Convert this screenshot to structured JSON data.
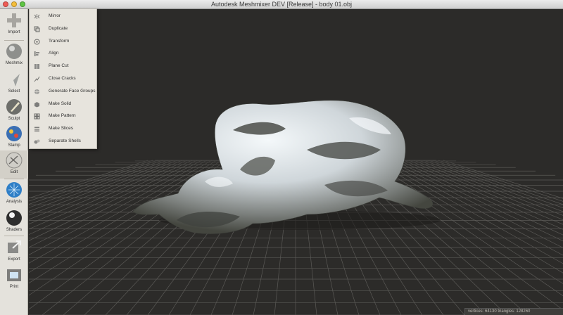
{
  "window": {
    "title": "Autodesk Meshmixer DEV [Release] - body 01.obj"
  },
  "toolbar": {
    "tools": [
      {
        "id": "import",
        "label": "Import",
        "icon": "plus-icon"
      },
      {
        "id": "meshmix",
        "label": "Meshmix",
        "icon": "meshmix-icon"
      },
      {
        "id": "select",
        "label": "Select",
        "icon": "select-arrow-icon"
      },
      {
        "id": "sculpt",
        "label": "Sculpt",
        "icon": "brush-icon"
      },
      {
        "id": "stamp",
        "label": "Stamp",
        "icon": "stamp-icon"
      },
      {
        "id": "edit",
        "label": "Edit",
        "icon": "edit-icon",
        "active": true
      },
      {
        "id": "analysis",
        "label": "Analysis",
        "icon": "analysis-icon"
      },
      {
        "id": "shaders",
        "label": "Shaders",
        "icon": "shader-sphere-icon"
      },
      {
        "id": "export",
        "label": "Export",
        "icon": "export-icon"
      },
      {
        "id": "print",
        "label": "Print",
        "icon": "printer-icon"
      }
    ]
  },
  "edit_menu": {
    "items": [
      {
        "label": "Mirror",
        "icon": "mirror-icon"
      },
      {
        "label": "Duplicate",
        "icon": "duplicate-icon"
      },
      {
        "label": "Transform",
        "icon": "transform-icon"
      },
      {
        "label": "Align",
        "icon": "align-icon"
      },
      {
        "label": "Plane Cut",
        "icon": "plane-cut-icon"
      },
      {
        "label": "Close Cracks",
        "icon": "close-cracks-icon"
      },
      {
        "label": "Generate Face Groups",
        "icon": "face-groups-icon"
      },
      {
        "label": "Make Solid",
        "icon": "make-solid-icon"
      },
      {
        "label": "Make Pattern",
        "icon": "make-pattern-icon"
      },
      {
        "label": "Make Slices",
        "icon": "make-slices-icon"
      },
      {
        "label": "Separate Shells",
        "icon": "separate-shells-icon"
      }
    ]
  },
  "status": {
    "text": "vertices: 64130  triangles: 128260"
  },
  "colors": {
    "viewport_bg": "#2c2b29",
    "grid": "#5a5956",
    "mesh_light": "#e8eef2",
    "mesh_dark": "#4a4c48",
    "toolbar_bg": "#e4e2dc"
  }
}
